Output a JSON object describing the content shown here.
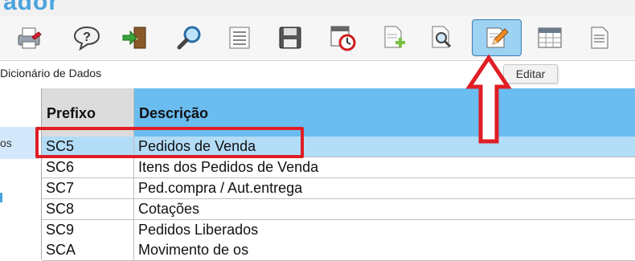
{
  "app": {
    "title_fragment": "ador"
  },
  "toolbar": {
    "buttons": [
      {
        "icon": "printer-icon",
        "name": "print-button"
      },
      {
        "icon": "help-icon",
        "name": "help-button"
      },
      {
        "icon": "exit-door-icon",
        "name": "exit-button"
      },
      {
        "icon": "search-icon",
        "name": "search-button"
      },
      {
        "icon": "list-view-icon",
        "name": "view-button"
      },
      {
        "icon": "save-icon",
        "name": "save-button"
      },
      {
        "icon": "schedule-icon",
        "name": "schedule-button"
      },
      {
        "icon": "add-document-icon",
        "name": "add-button"
      },
      {
        "icon": "preview-icon",
        "name": "preview-button"
      },
      {
        "icon": "edit-icon",
        "name": "edit-button",
        "active": true
      },
      {
        "icon": "table-icon",
        "name": "table-button"
      },
      {
        "icon": "document-icon",
        "name": "document-button"
      }
    ],
    "tooltip": "Editar"
  },
  "breadcrumb": "Dicionário de Dados",
  "left_panel": {
    "selected_item": "os"
  },
  "grid": {
    "columns": [
      "Prefixo",
      "Descrição"
    ],
    "rows": [
      {
        "prefixo": "SC5",
        "descricao": "Pedidos de Venda",
        "selected": true
      },
      {
        "prefixo": "SC6",
        "descricao": "Itens dos Pedidos de Venda"
      },
      {
        "prefixo": "SC7",
        "descricao": "Ped.compra / Aut.entrega"
      },
      {
        "prefixo": "SC8",
        "descricao": "Cotações"
      },
      {
        "prefixo": "SC9",
        "descricao": "Pedidos Liberados"
      },
      {
        "prefixo": "SCA",
        "descricao": "Movimento de os"
      }
    ]
  },
  "colors": {
    "header_blue": "#6bbcf0",
    "selected_row": "#b3dcf7",
    "annotation_red": "#e01e25"
  }
}
